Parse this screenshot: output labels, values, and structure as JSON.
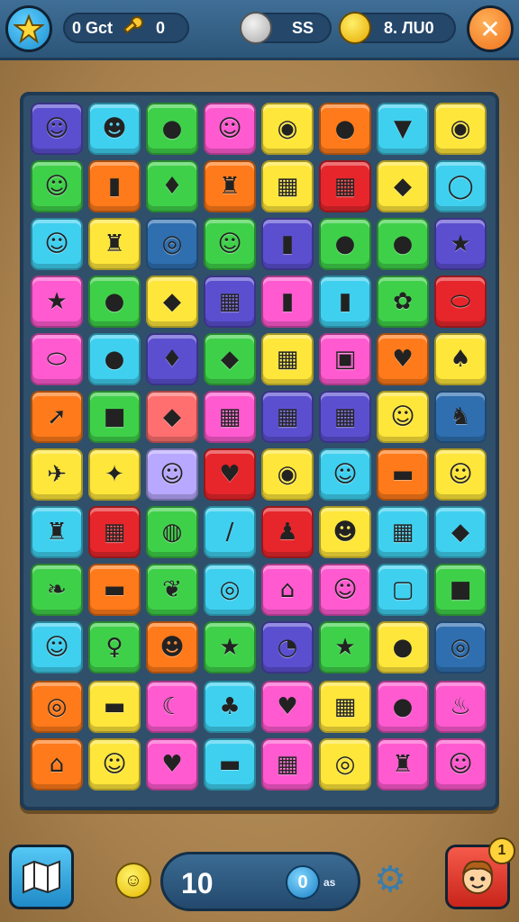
{
  "topbar": {
    "lives_text": "0 Gct",
    "keys_text": "0",
    "silver_text": "SS",
    "gold_text": "8. ЛU0",
    "close_symbol": "✕"
  },
  "board": {
    "cols": 8,
    "rows": 12,
    "tiles": [
      {
        "color": "#5b4fd0",
        "sym": "☺"
      },
      {
        "color": "#3fd0f0",
        "sym": "☻"
      },
      {
        "color": "#3fd04a",
        "sym": "●"
      },
      {
        "color": "#ff5ad0",
        "sym": "☺"
      },
      {
        "color": "#ffe63a",
        "sym": "◉"
      },
      {
        "color": "#ff7a1a",
        "sym": "●"
      },
      {
        "color": "#3fd0f0",
        "sym": "▼"
      },
      {
        "color": "#ffe63a",
        "sym": "◉"
      },
      {
        "color": "#3fd04a",
        "sym": "☺"
      },
      {
        "color": "#ff7a1a",
        "sym": "▮"
      },
      {
        "color": "#3fd04a",
        "sym": "♦"
      },
      {
        "color": "#ff7a1a",
        "sym": "♜"
      },
      {
        "color": "#ffe63a",
        "sym": "▦"
      },
      {
        "color": "#e6262b",
        "sym": "▦"
      },
      {
        "color": "#ffe63a",
        "sym": "◆"
      },
      {
        "color": "#3fd0f0",
        "sym": "◯"
      },
      {
        "color": "#3fd0f0",
        "sym": "☺"
      },
      {
        "color": "#ffe63a",
        "sym": "♜"
      },
      {
        "color": "#2f6fb0",
        "sym": "◎"
      },
      {
        "color": "#3fd04a",
        "sym": "☺"
      },
      {
        "color": "#5b4fd0",
        "sym": "▮"
      },
      {
        "color": "#3fd04a",
        "sym": "●"
      },
      {
        "color": "#3fd04a",
        "sym": "●"
      },
      {
        "color": "#5b4fd0",
        "sym": "★"
      },
      {
        "color": "#ff5ad0",
        "sym": "★"
      },
      {
        "color": "#3fd04a",
        "sym": "●"
      },
      {
        "color": "#ffe63a",
        "sym": "◆"
      },
      {
        "color": "#5b4fd0",
        "sym": "▦"
      },
      {
        "color": "#ff5ad0",
        "sym": "▮"
      },
      {
        "color": "#3fd0f0",
        "sym": "▮"
      },
      {
        "color": "#3fd04a",
        "sym": "✿"
      },
      {
        "color": "#e6262b",
        "sym": "⬭"
      },
      {
        "color": "#ff5ad0",
        "sym": "⬭"
      },
      {
        "color": "#3fd0f0",
        "sym": "●"
      },
      {
        "color": "#5b4fd0",
        "sym": "♦"
      },
      {
        "color": "#3fd04a",
        "sym": "◆"
      },
      {
        "color": "#ffe63a",
        "sym": "▦"
      },
      {
        "color": "#ff5ad0",
        "sym": "▣"
      },
      {
        "color": "#ff7a1a",
        "sym": "♥"
      },
      {
        "color": "#ffe63a",
        "sym": "♠"
      },
      {
        "color": "#ff7a1a",
        "sym": "➚"
      },
      {
        "color": "#3fd04a",
        "sym": "■"
      },
      {
        "color": "#ff6f6f",
        "sym": "◆"
      },
      {
        "color": "#ff5ad0",
        "sym": "▦"
      },
      {
        "color": "#5b4fd0",
        "sym": "▦"
      },
      {
        "color": "#5b4fd0",
        "sym": "▦"
      },
      {
        "color": "#ffe63a",
        "sym": "☺"
      },
      {
        "color": "#2f6fb0",
        "sym": "♞"
      },
      {
        "color": "#ffe63a",
        "sym": "✈"
      },
      {
        "color": "#ffe63a",
        "sym": "✦"
      },
      {
        "color": "#b8a8ff",
        "sym": "☺"
      },
      {
        "color": "#e6262b",
        "sym": "♥"
      },
      {
        "color": "#ffe63a",
        "sym": "◉"
      },
      {
        "color": "#3fd0f0",
        "sym": "☺"
      },
      {
        "color": "#ff7a1a",
        "sym": "▬"
      },
      {
        "color": "#ffe63a",
        "sym": "☺"
      },
      {
        "color": "#3fd0f0",
        "sym": "♜"
      },
      {
        "color": "#e6262b",
        "sym": "▦"
      },
      {
        "color": "#3fd04a",
        "sym": "◍"
      },
      {
        "color": "#3fd0f0",
        "sym": "/"
      },
      {
        "color": "#e6262b",
        "sym": "♟"
      },
      {
        "color": "#ffe63a",
        "sym": "☻"
      },
      {
        "color": "#3fd0f0",
        "sym": "▦"
      },
      {
        "color": "#3fd0f0",
        "sym": "◆"
      },
      {
        "color": "#3fd04a",
        "sym": "❧"
      },
      {
        "color": "#ff7a1a",
        "sym": "▬"
      },
      {
        "color": "#3fd04a",
        "sym": "❦"
      },
      {
        "color": "#3fd0f0",
        "sym": "◎"
      },
      {
        "color": "#ff5ad0",
        "sym": "⌂"
      },
      {
        "color": "#ff5ad0",
        "sym": "☺"
      },
      {
        "color": "#3fd0f0",
        "sym": "▢"
      },
      {
        "color": "#3fd04a",
        "sym": "■"
      },
      {
        "color": "#3fd0f0",
        "sym": "☺"
      },
      {
        "color": "#3fd04a",
        "sym": "♀"
      },
      {
        "color": "#ff7a1a",
        "sym": "☻"
      },
      {
        "color": "#3fd04a",
        "sym": "★"
      },
      {
        "color": "#5b4fd0",
        "sym": "◔"
      },
      {
        "color": "#3fd04a",
        "sym": "★"
      },
      {
        "color": "#ffe63a",
        "sym": "●"
      },
      {
        "color": "#2f6fb0",
        "sym": "◎"
      },
      {
        "color": "#ff7a1a",
        "sym": "◎"
      },
      {
        "color": "#ffe63a",
        "sym": "▬"
      },
      {
        "color": "#ff5ad0",
        "sym": "☾"
      },
      {
        "color": "#3fd0f0",
        "sym": "♣"
      },
      {
        "color": "#ff5ad0",
        "sym": "♥"
      },
      {
        "color": "#ffe63a",
        "sym": "▦"
      },
      {
        "color": "#ff5ad0",
        "sym": "●"
      },
      {
        "color": "#ff5ad0",
        "sym": "♨"
      },
      {
        "color": "#ff7a1a",
        "sym": "⌂"
      },
      {
        "color": "#ffe63a",
        "sym": "☺"
      },
      {
        "color": "#ff5ad0",
        "sym": "♥"
      },
      {
        "color": "#3fd0f0",
        "sym": "▬"
      },
      {
        "color": "#ff5ad0",
        "sym": "▦"
      },
      {
        "color": "#ffe63a",
        "sym": "◎"
      },
      {
        "color": "#ff5ad0",
        "sym": "♜"
      },
      {
        "color": "#ff5ad0",
        "sym": "☺"
      }
    ]
  },
  "bottombar": {
    "score": "10",
    "moves_value": "0",
    "moves_label": "as",
    "badge_value": "1",
    "coin_symbol": "☺",
    "gear_symbol": "⚙"
  }
}
